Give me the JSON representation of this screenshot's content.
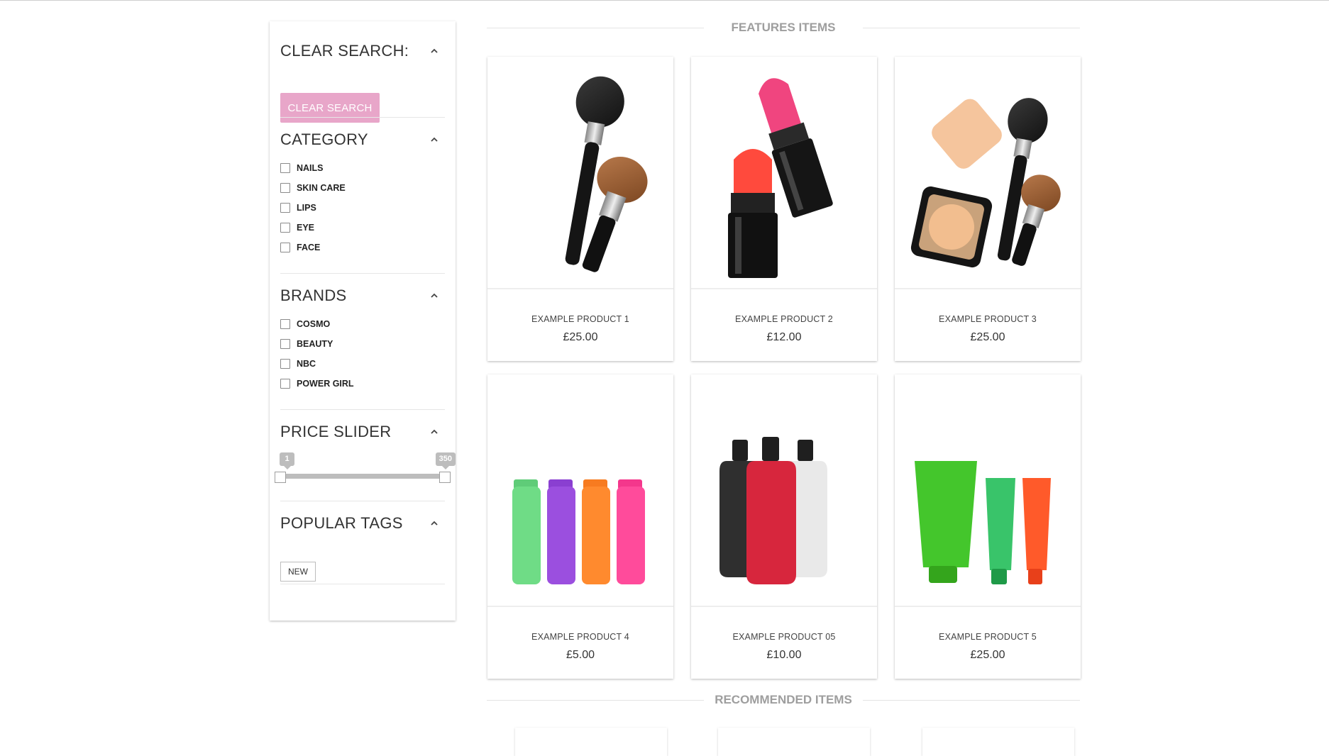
{
  "sidebar": {
    "clear_search": {
      "title": "CLEAR SEARCH:",
      "button": "CLEAR SEARCH"
    },
    "category": {
      "title": "CATEGORY",
      "items": [
        "NAILS",
        "SKIN CARE",
        "LIPS",
        "EYE",
        "FACE"
      ]
    },
    "brands": {
      "title": "BRANDS",
      "items": [
        "COSMO",
        "BEAUTY",
        "NBC",
        "POWER GIRL"
      ]
    },
    "price_slider": {
      "title": "PRICE SLIDER",
      "min_value": "1",
      "max_value": "350"
    },
    "popular_tags": {
      "title": "POPULAR TAGS",
      "tags": [
        "NEW"
      ]
    }
  },
  "features": {
    "heading": "FEATURES ITEMS",
    "products": [
      {
        "name": "EXAMPLE PRODUCT 1",
        "price": "£25.00",
        "image": "makeup-brushes"
      },
      {
        "name": "EXAMPLE PRODUCT 2",
        "price": "£12.00",
        "image": "lipsticks"
      },
      {
        "name": "EXAMPLE PRODUCT 3",
        "price": "£25.00",
        "image": "compact-powder-and-brushes"
      },
      {
        "name": "EXAMPLE PRODUCT 4",
        "price": "£5.00",
        "image": "colorful-bottles"
      },
      {
        "name": "EXAMPLE PRODUCT 05",
        "price": "£10.00",
        "image": "lotion-bottles"
      },
      {
        "name": "EXAMPLE PRODUCT 5",
        "price": "£25.00",
        "image": "cream-tubes"
      }
    ]
  },
  "recommended": {
    "heading": "RECOMMENDED ITEMS"
  },
  "colors": {
    "accent_pink": "#e8a6c9",
    "heading_gray": "#9e9e9e",
    "slider_gray": "#bdbdbd"
  }
}
